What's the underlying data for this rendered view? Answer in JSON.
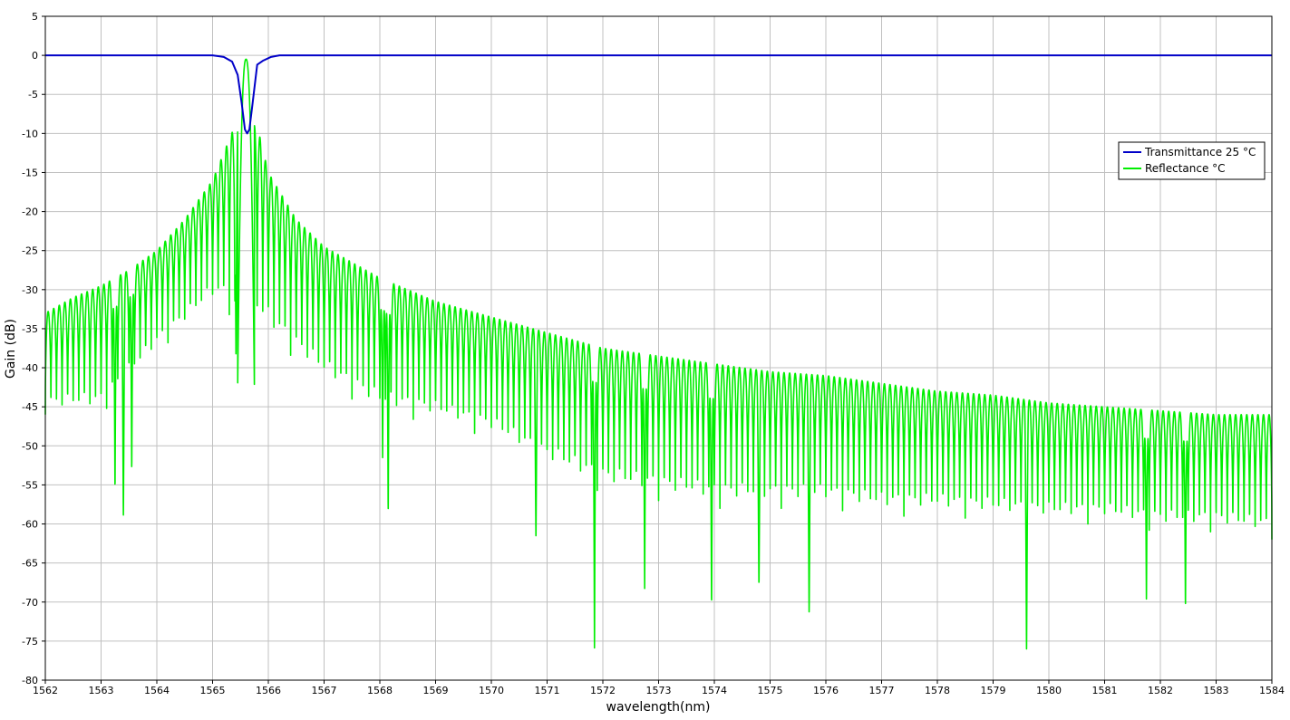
{
  "chart_data": {
    "type": "line",
    "xlabel": "wavelength(nm)",
    "ylabel": "Gain (dB)",
    "xlim": [
      1562,
      1584
    ],
    "ylim": [
      -80,
      5
    ],
    "xticks": [
      "1562",
      "1563",
      "1564",
      "1565",
      "1566",
      "1567",
      "1568",
      "1569",
      "1570",
      "1571",
      "1572",
      "1573",
      "1574",
      "1575",
      "1576",
      "1577",
      "1578",
      "1579",
      "1580",
      "1581",
      "1582",
      "1583",
      "1584"
    ],
    "yticks": [
      "5",
      "0",
      "-5",
      "-10",
      "-15",
      "-20",
      "-25",
      "-30",
      "-35",
      "-40",
      "-45",
      "-50",
      "-55",
      "-60",
      "-65",
      "-70",
      "-75",
      "-80"
    ],
    "grid": true,
    "legend_position": "top-right",
    "colors": {
      "transmittance": "#0000c8",
      "reflectance": "#00ee00",
      "grid": "#c0c0c0"
    },
    "center_wavelength": 1565.6,
    "series": [
      {
        "name": "Transmittance 25 °C",
        "x": [
          1562,
          1565.0,
          1565.2,
          1565.35,
          1565.45,
          1565.52,
          1565.58,
          1565.62,
          1565.66,
          1565.72,
          1565.8,
          1565.9,
          1566.05,
          1566.2,
          1584
        ],
        "values": [
          0,
          0,
          -0.2,
          -0.8,
          -2.5,
          -6,
          -9.5,
          -10,
          -9.5,
          -6,
          -1.2,
          -0.7,
          -0.2,
          0,
          0
        ]
      },
      {
        "name": "Reflectance °C",
        "peak": {
          "x": 1565.6,
          "value": -0.5
        },
        "sidelobe_envelope": {
          "x": [
            1562,
            1562.5,
            1563,
            1563.5,
            1564,
            1564.5,
            1565,
            1565.4,
            1565.8,
            1566,
            1566.5,
            1567,
            1568,
            1569,
            1570,
            1571,
            1572,
            1573,
            1574,
            1575,
            1576,
            1577,
            1578,
            1579,
            1580,
            1581,
            1582,
            1583,
            1584
          ],
          "values": [
            -33,
            -31,
            -29.5,
            -27.5,
            -25,
            -21,
            -16,
            -9,
            -9,
            -15,
            -21,
            -24.5,
            -28.5,
            -31.5,
            -33.5,
            -35.5,
            -37.5,
            -38.5,
            -39.5,
            -40.5,
            -41,
            -42,
            -43,
            -43.5,
            -44.5,
            -45,
            -45.5,
            -46,
            -46
          ]
        },
        "null_floor": {
          "x": [
            1562,
            1563,
            1564,
            1565,
            1566,
            1567,
            1568,
            1569,
            1570,
            1571,
            1572,
            1573,
            1574,
            1575,
            1576,
            1577,
            1578,
            1579,
            1580,
            1581,
            1582,
            1583,
            1584
          ],
          "values": [
            -46,
            -46,
            -38,
            -32,
            -36,
            -42,
            -46,
            -47,
            -49,
            -53,
            -56,
            -57,
            -58,
            -58,
            -58,
            -59,
            -59,
            -59.5,
            -60,
            -60,
            -61,
            -61,
            -62
          ]
        },
        "fringe_period_nm": 0.1,
        "deep_nulls": [
          {
            "x": 1563.25,
            "value": -56
          },
          {
            "x": 1563.4,
            "value": -59
          },
          {
            "x": 1563.55,
            "value": -53.5
          },
          {
            "x": 1565.42,
            "value": -39
          },
          {
            "x": 1568.05,
            "value": -51.5
          },
          {
            "x": 1568.15,
            "value": -59
          },
          {
            "x": 1570.8,
            "value": -61.5
          },
          {
            "x": 1571.85,
            "value": -76.5
          },
          {
            "x": 1572.75,
            "value": -68.5
          },
          {
            "x": 1573.95,
            "value": -71
          },
          {
            "x": 1574.8,
            "value": -68
          },
          {
            "x": 1575.7,
            "value": -71.5
          },
          {
            "x": 1579.6,
            "value": -76
          },
          {
            "x": 1581.75,
            "value": -70
          },
          {
            "x": 1582.45,
            "value": -71
          }
        ]
      }
    ]
  }
}
